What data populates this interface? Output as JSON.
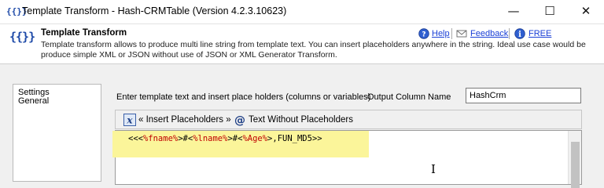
{
  "window": {
    "icon_text": "{{}}",
    "title": "Template Transform - Hash-CRMTable (Version 4.2.3.10623)",
    "controls": {
      "minimize": "—",
      "maximize": "☐",
      "close": "✕"
    }
  },
  "header": {
    "icon_text": "{{}}",
    "title": "Template Transform",
    "description": "Template transform allows to produce multi line string from template text. You can insert placeholders anywhere in the string. Ideal use case would be produce simple XML or JSON without use of JSON or XML Generator Transform.",
    "links": {
      "help": "Help",
      "feedback": "Feedback",
      "free": "FREE"
    },
    "icons": [
      "help-icon",
      "feedback-icon",
      "info-icon"
    ]
  },
  "sidebar": {
    "items": [
      "Settings",
      "General"
    ]
  },
  "main": {
    "instruction": "Enter template text and insert place holders (columns or variables)",
    "output_column_label": "Output Column Name",
    "output_column_value": "HashCrm",
    "toolbar": {
      "insert_placeholders": "« Insert Placeholders »",
      "text_without_placeholders": "Text Without Placeholders"
    },
    "editor": {
      "code": "<<<%fname%>#<%lname%>#<%Age%>,FUN_MD5>>",
      "highlight_color": "#fbf59a"
    }
  }
}
